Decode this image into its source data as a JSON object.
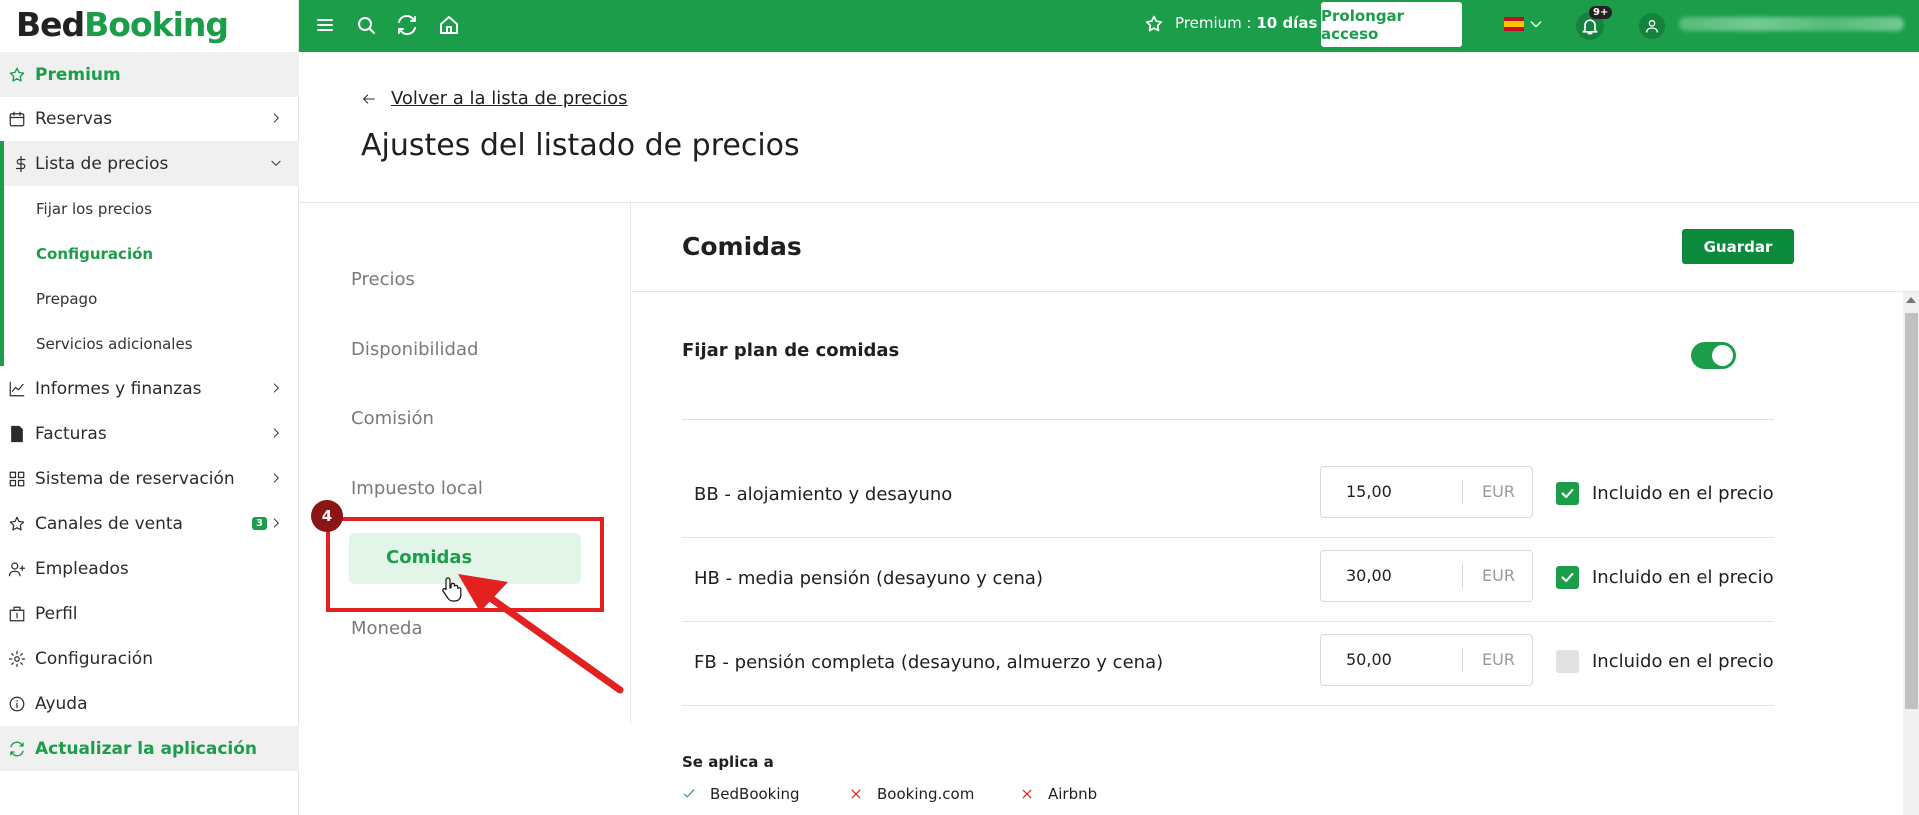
{
  "app": {
    "logo_part1": "Bed",
    "logo_part2": "Booking"
  },
  "sidebar": {
    "premium": "Premium",
    "items": [
      {
        "label": "Reservas"
      },
      {
        "label": "Lista de precios"
      },
      {
        "label": "Informes y finanzas"
      },
      {
        "label": "Facturas"
      },
      {
        "label": "Sistema de reservación"
      },
      {
        "label": "Canales de venta",
        "badge": "3"
      },
      {
        "label": "Empleados"
      },
      {
        "label": "Perfil"
      },
      {
        "label": "Configuración"
      },
      {
        "label": "Ayuda"
      }
    ],
    "sub_items": [
      {
        "label": "Fijar los precios"
      },
      {
        "label": "Configuración"
      },
      {
        "label": "Prepago"
      },
      {
        "label": "Servicios adicionales"
      }
    ],
    "update_app": "Actualizar la aplicación"
  },
  "topbar": {
    "premium_label": "Premium : ",
    "premium_days": "10 días",
    "prolong_button": "Prolongar acceso",
    "notif_badge": "9+"
  },
  "header": {
    "back_link": "Volver a la lista de precios",
    "title": "Ajustes del listado de precios"
  },
  "settings_menu": {
    "items": [
      "Precios",
      "Disponibilidad",
      "Comisión",
      "Impuesto local",
      "Comidas",
      "Moneda"
    ],
    "active": "Comidas"
  },
  "annotation": {
    "step": "4"
  },
  "content": {
    "title": "Comidas",
    "save_button": "Guardar",
    "meal_plan_label": "Fijar plan de comidas",
    "meal_plan_enabled": true,
    "meals": [
      {
        "name": "BB - alojamiento y desayuno",
        "price": "15,00",
        "currency": "EUR",
        "included": true,
        "included_label": "Incluido en el precio"
      },
      {
        "name": "HB - media pensión (desayuno y cena)",
        "price": "30,00",
        "currency": "EUR",
        "included": true,
        "included_label": "Incluido en el precio"
      },
      {
        "name": "FB - pensión completa (desayuno, almuerzo y cena)",
        "price": "50,00",
        "currency": "EUR",
        "included": false,
        "included_label": "Incluido en el precio"
      }
    ],
    "applies_to_label": "Se aplica a",
    "channels": [
      {
        "name": "BedBooking",
        "enabled": true
      },
      {
        "name": "Booking.com",
        "enabled": false
      },
      {
        "name": "Airbnb",
        "enabled": false
      }
    ]
  },
  "colors": {
    "brand_green": "#1b9d4a",
    "annotation_red": "#e32121"
  }
}
